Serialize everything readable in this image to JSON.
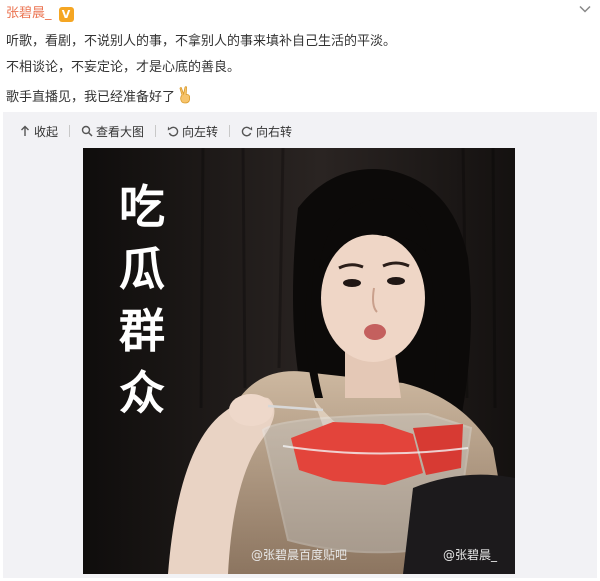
{
  "post": {
    "author": "张碧晨_",
    "badge": "V",
    "lines": [
      "听歌，看剧，不说别人的事，不拿别人的事来填补自己生活的平淡。",
      "不相谈论，不妄定论，才是心底的善良。",
      "歌手直播见，我已经准备好了"
    ],
    "emoji": "victory-hand-emoji"
  },
  "media": {
    "toolbar": [
      {
        "label": "收起",
        "icon": "collapse-icon"
      },
      {
        "label": "查看大图",
        "icon": "search-icon"
      },
      {
        "label": "向左转",
        "icon": "rotate-left-icon"
      },
      {
        "label": "向右转",
        "icon": "rotate-right-icon"
      }
    ],
    "image": {
      "caption_chars": [
        "吃",
        "瓜",
        "群",
        "众"
      ],
      "watermark_left": "@张碧晨百度贴吧",
      "watermark_right": "@张碧晨_"
    }
  },
  "colors": {
    "author": "#eb7350",
    "badge": "#f5a623",
    "media_bg": "#f2f2f5"
  }
}
